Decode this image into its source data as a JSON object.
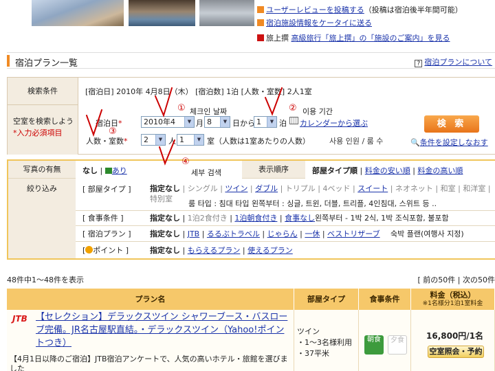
{
  "top_links": [
    {
      "link": "ユーザーレビューを投稿する",
      "suffix": "（投稿は宿泊後半年間可能）"
    },
    {
      "link": "宿泊施設情報をケータイに送る",
      "suffix": ""
    },
    {
      "prefix": "旅上撰",
      "link": "高級旅行「旅上撰」の「施設のご案内」を見る",
      "suffix": ""
    }
  ],
  "header": {
    "title": "宿泊プラン一覧",
    "help_link": "宿泊プランについて",
    "help_icon": "help-icon"
  },
  "search": {
    "label_conditions": "検索条件",
    "conditions_text": "[宿泊日] 2010年 4月8日（木） [宿泊数] 1泊 [人数・室数] 2人1室",
    "label_vacancy_line1": "空室を検索しよう",
    "label_vacancy_line2": "*入力必須項目",
    "checkin_label": "宿泊日",
    "year_month": "2010年4",
    "month_unit": "月",
    "day": "8",
    "day_unit": "日から",
    "nights": "1",
    "nights_unit": "泊",
    "calendar_link": "カレンダーから選ぶ",
    "people_label": "人数・室数",
    "people": "2",
    "people_unit": "人",
    "rooms": "1",
    "rooms_note": "室（人数は1室あたりの人数）",
    "korean_people_rooms": "사용 인원 / 룸 수",
    "search_button": "検 索",
    "reset_link": "条件を設定しなおす"
  },
  "filters": {
    "photo_label": "写真の有無",
    "photo_none": "なし",
    "photo_yes": "あり",
    "sort_label": "表示順序",
    "sort_options": [
      "部屋タイプ順",
      "料金の安い順",
      "料金の高い順"
    ],
    "narrow_label": "絞り込み",
    "room_type_label": "[ 部屋タイプ ]",
    "room_types": [
      "指定なし",
      "シングル",
      "ツイン",
      "ダブル",
      "トリプル",
      "4ベッド",
      "スイート",
      "ネオネット",
      "和室",
      "和洋室",
      "特別室"
    ],
    "room_type_korean": "룸 타입 : 침대 타입 왼쪽부터 : 싱글, 트윈, 더블, 트리플, 4인침대, 스위트 등 ..",
    "meal_label": "[ 食事条件 ]",
    "meals": [
      "指定なし",
      "1泊2食付き",
      "1泊朝食付き",
      "食事なし"
    ],
    "meal_korean": "왼쪽부터 - 1박 2식, 1박 조식포함, 불포함",
    "plan_label": "[ 宿泊プラン ]",
    "plans": [
      "指定なし",
      "JTB",
      "るるぶトラベル",
      "じゃらん",
      "一休",
      "ベストリザーブ"
    ],
    "plan_korean": "숙박 플랜(여행사 지정)",
    "point_label": "ポイント ]",
    "points": [
      "指定なし",
      "もらえるプラン",
      "使えるプラン"
    ]
  },
  "results": {
    "count_text": "48件中1〜48件を表示",
    "pager_prev": "前の50件",
    "pager_next": "次の50件",
    "columns": [
      "プラン名",
      "部屋タイプ",
      "食事条件",
      "料金（税込）"
    ],
    "price_note": "※1名様分1泊1室料金",
    "row": {
      "provider": "JTB",
      "plan_name": "【セレクション】デラックスツイン シャワーブース・バスローブ完備。JR名古屋駅直結。・デラックスツイン（Yahoo!ポイントつき）",
      "description": "【4月1日以降のご宿泊】JTB宿泊アンケートで、人気の高いホテル・旅館を選びました",
      "room_type": "ツイン",
      "capacity": "・1〜3名様利用",
      "area": "・37平米",
      "meal_breakfast": "朝食",
      "meal_dinner": "夕食",
      "price": "16,800円/1名",
      "reserve_button": "空室照会・予約"
    }
  },
  "annotations": {
    "n1": "①",
    "t1": "체크인 날짜",
    "n2": "②",
    "t2": "이용 기간",
    "n3": "③",
    "n4": "④",
    "t4": "세부 검색"
  },
  "colors": {
    "accent": "#f08a24",
    "link": "#1a33aa",
    "ink": "#cc0000",
    "table_header": "#f6c86a"
  }
}
